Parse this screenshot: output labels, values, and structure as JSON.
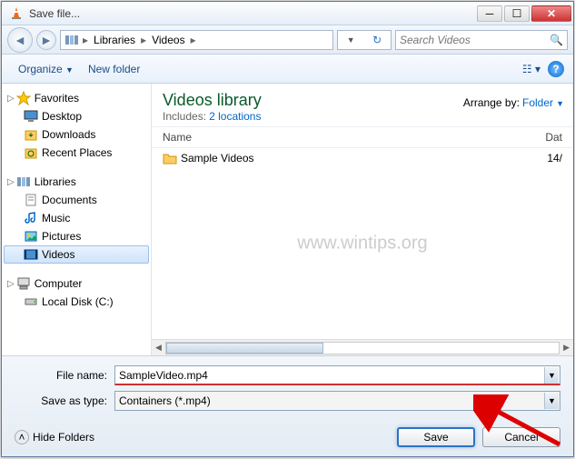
{
  "title": "Save file...",
  "breadcrumb": {
    "root": "Libraries",
    "folder": "Videos"
  },
  "search": {
    "placeholder": "Search Videos"
  },
  "toolbar": {
    "organize": "Organize",
    "newfolder": "New folder"
  },
  "sidebar": {
    "favorites": {
      "label": "Favorites",
      "items": [
        "Desktop",
        "Downloads",
        "Recent Places"
      ]
    },
    "libraries": {
      "label": "Libraries",
      "items": [
        "Documents",
        "Music",
        "Pictures",
        "Videos"
      ]
    },
    "computer": {
      "label": "Computer",
      "items": [
        "Local Disk (C:)"
      ]
    }
  },
  "library": {
    "title": "Videos library",
    "includes_label": "Includes:",
    "locations": "2 locations",
    "arrange_label": "Arrange by:",
    "arrange_value": "Folder"
  },
  "columns": {
    "name": "Name",
    "date": "Dat"
  },
  "files": [
    {
      "name": "Sample Videos",
      "date": "14/"
    }
  ],
  "watermark": "www.wintips.org",
  "fields": {
    "filename_label": "File name:",
    "filename_value": "SampleVideo.mp4",
    "saveastype_label": "Save as type:",
    "saveastype_value": "Containers (*.mp4)"
  },
  "buttons": {
    "hide": "Hide Folders",
    "save": "Save",
    "cancel": "Cancel"
  }
}
